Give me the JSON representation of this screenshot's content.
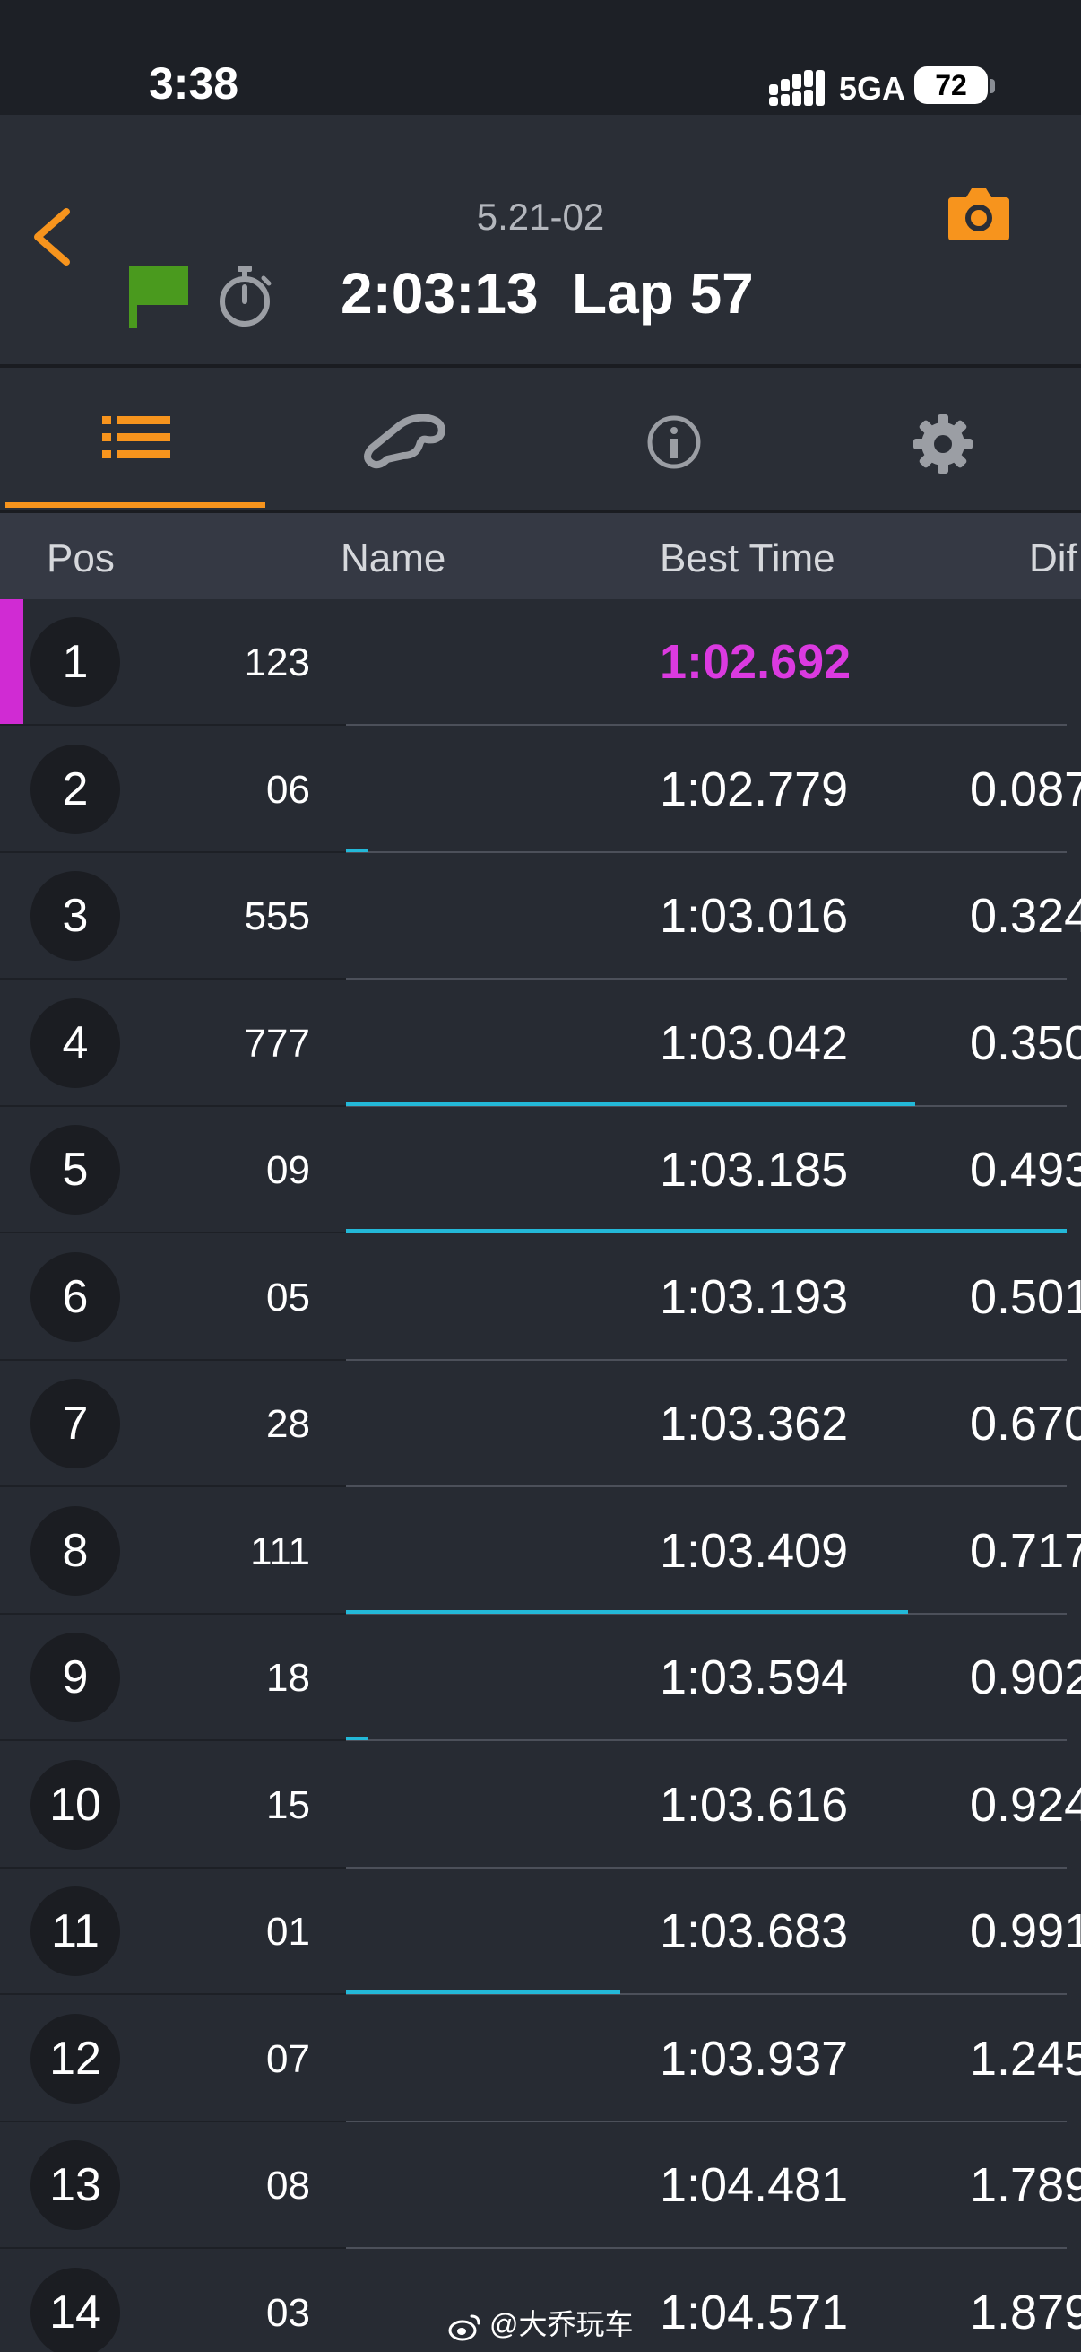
{
  "status_bar": {
    "time": "3:38",
    "network": "5GA",
    "battery": "72"
  },
  "header": {
    "session": "5.21-02",
    "elapsed": "2:03:13",
    "lap": "Lap 57",
    "accent_color": "#f7941d",
    "flag_color": "#4a9a1e",
    "icons": [
      "chevron-left-icon",
      "camera-icon",
      "green-flag-icon",
      "stopwatch-icon"
    ]
  },
  "tabs": [
    {
      "name": "list",
      "icon": "list-icon",
      "active": true
    },
    {
      "name": "track",
      "icon": "track-map-icon",
      "active": false
    },
    {
      "name": "info",
      "icon": "info-icon",
      "active": false
    },
    {
      "name": "settings",
      "icon": "gear-icon",
      "active": false
    }
  ],
  "columns": {
    "pos": "Pos",
    "name": "Name",
    "best": "Best Time",
    "diff": "Dif"
  },
  "fastest_color": "#db3ae0",
  "gap_bar_color": "#23b8d8",
  "rows": [
    {
      "pos": "1",
      "car": "123",
      "best": "1:02.692",
      "gap": "",
      "bar": 0
    },
    {
      "pos": "2",
      "car": "06",
      "best": "1:02.779",
      "gap": "0.087",
      "bar": 0.03
    },
    {
      "pos": "3",
      "car": "555",
      "best": "1:03.016",
      "gap": "0.324",
      "bar": 0
    },
    {
      "pos": "4",
      "car": "777",
      "best": "1:03.042",
      "gap": "0.350",
      "bar": 0.79
    },
    {
      "pos": "5",
      "car": "09",
      "best": "1:03.185",
      "gap": "0.493",
      "bar": 1.0
    },
    {
      "pos": "6",
      "car": "05",
      "best": "1:03.193",
      "gap": "0.501",
      "bar": 0
    },
    {
      "pos": "7",
      "car": "28",
      "best": "1:03.362",
      "gap": "0.670",
      "bar": 0
    },
    {
      "pos": "8",
      "car": "111",
      "best": "1:03.409",
      "gap": "0.717",
      "bar": 0.78
    },
    {
      "pos": "9",
      "car": "18",
      "best": "1:03.594",
      "gap": "0.902",
      "bar": 0.03
    },
    {
      "pos": "10",
      "car": "15",
      "best": "1:03.616",
      "gap": "0.924",
      "bar": 0
    },
    {
      "pos": "11",
      "car": "01",
      "best": "1:03.683",
      "gap": "0.991",
      "bar": 0.38
    },
    {
      "pos": "12",
      "car": "07",
      "best": "1:03.937",
      "gap": "1.245",
      "bar": 0
    },
    {
      "pos": "13",
      "car": "08",
      "best": "1:04.481",
      "gap": "1.789",
      "bar": 0
    },
    {
      "pos": "14",
      "car": "03",
      "best": "1:04.571",
      "gap": "1.879",
      "bar": 0
    }
  ],
  "watermark": "@大乔玩车"
}
